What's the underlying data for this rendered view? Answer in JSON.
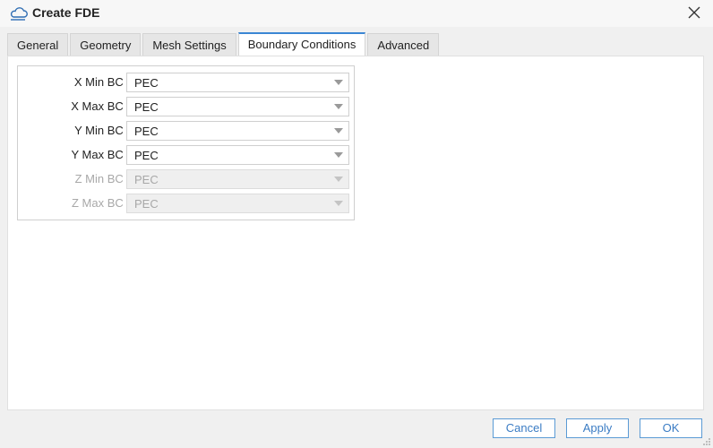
{
  "window": {
    "title": "Create FDE",
    "icon": "cloud-icon"
  },
  "tabs": [
    {
      "label": "General",
      "active": false
    },
    {
      "label": "Geometry",
      "active": false
    },
    {
      "label": "Mesh Settings",
      "active": false
    },
    {
      "label": "Boundary Conditions",
      "active": true
    },
    {
      "label": "Advanced",
      "active": false
    }
  ],
  "boundary_conditions": {
    "rows": [
      {
        "label": "X Min BC :",
        "value": "PEC",
        "enabled": true
      },
      {
        "label": "X Max BC :",
        "value": "PEC",
        "enabled": true
      },
      {
        "label": "Y Min BC :",
        "value": "PEC",
        "enabled": true
      },
      {
        "label": "Y Max BC :",
        "value": "PEC",
        "enabled": true
      },
      {
        "label": "Z Min BC :",
        "value": "PEC",
        "enabled": false
      },
      {
        "label": "Z Max BC :",
        "value": "PEC",
        "enabled": false
      }
    ]
  },
  "footer": {
    "cancel_label": "Cancel",
    "apply_label": "Apply",
    "ok_label": "OK"
  },
  "colors": {
    "accent": "#3b86d4",
    "button_text": "#3b7cc4"
  }
}
